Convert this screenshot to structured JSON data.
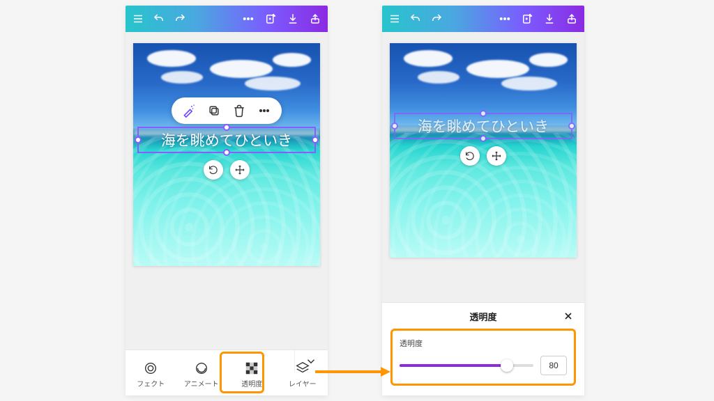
{
  "canvas_text": "海を眺めてひといき",
  "left": {
    "tools": [
      {
        "id": "effect",
        "label": "フェクト"
      },
      {
        "id": "animate",
        "label": "アニメート"
      },
      {
        "id": "opacity",
        "label": "透明度"
      },
      {
        "id": "layer",
        "label": "レイヤー"
      }
    ],
    "selected_tool": "opacity"
  },
  "right": {
    "panel_title": "透明度",
    "slider_label": "透明度",
    "opacity_value": 80
  },
  "colors": {
    "accent": "#8a2be2",
    "highlight": "#ff9500"
  }
}
